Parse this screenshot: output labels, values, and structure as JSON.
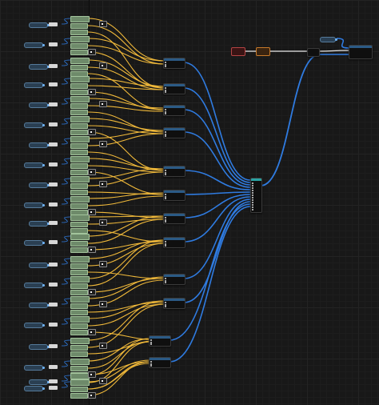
{
  "app": {
    "view": "blueprint-graph-editor"
  },
  "colors": {
    "canvas": "#181818",
    "exec_wire": "#e8e8e8",
    "data_wire_float": "#f0b93a",
    "data_wire_struct": "#2f7be0",
    "variable_node": "#557a9a",
    "literal_node": "#a3c49c",
    "event_node": "#b44444"
  },
  "graph": {
    "icons": [
      "variable-icon",
      "literal-icon",
      "function-node-icon",
      "make-struct-icon",
      "event-icon"
    ],
    "rows": 18,
    "function_nodes": 14,
    "has_make_array_node": true,
    "has_event_chain": true
  }
}
